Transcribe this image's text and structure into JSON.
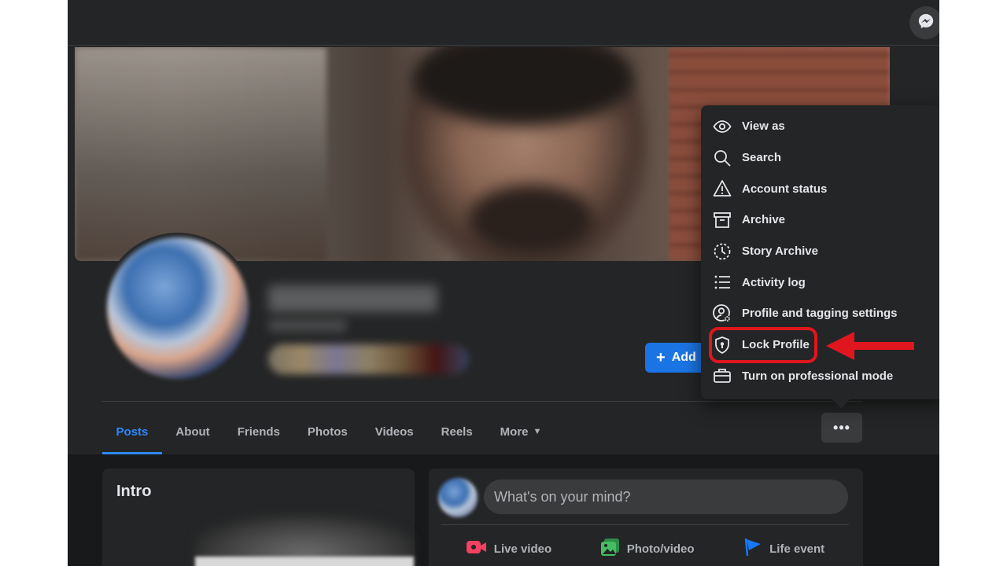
{
  "tabs": [
    {
      "label": "Posts"
    },
    {
      "label": "About"
    },
    {
      "label": "Friends"
    },
    {
      "label": "Photos"
    },
    {
      "label": "Videos"
    },
    {
      "label": "Reels"
    },
    {
      "label": "More"
    }
  ],
  "profile": {
    "add_button_label": "Add",
    "more_options_label": "•••"
  },
  "menu": {
    "items": [
      {
        "label": "View as",
        "icon": "eye-icon"
      },
      {
        "label": "Search",
        "icon": "search-icon"
      },
      {
        "label": "Account status",
        "icon": "warning-icon"
      },
      {
        "label": "Archive",
        "icon": "archive-icon"
      },
      {
        "label": "Story Archive",
        "icon": "clock-icon"
      },
      {
        "label": "Activity log",
        "icon": "list-icon"
      },
      {
        "label": "Profile and tagging settings",
        "icon": "user-settings-icon"
      },
      {
        "label": "Lock Profile",
        "icon": "shield-lock-icon"
      },
      {
        "label": "Turn on professional mode",
        "icon": "briefcase-icon"
      }
    ],
    "highlighted": "Lock Profile"
  },
  "intro": {
    "title": "Intro"
  },
  "composer": {
    "placeholder": "What's on your mind?",
    "actions": [
      {
        "label": "Live video",
        "icon": "live-video-icon",
        "color": "#f3425f"
      },
      {
        "label": "Photo/video",
        "icon": "photo-icon",
        "color": "#45bd62"
      },
      {
        "label": "Life event",
        "icon": "flag-icon",
        "color": "#1877f2"
      }
    ]
  },
  "colors": {
    "accent": "#2d88ff",
    "annotation_red": "#e0161e",
    "page_bg": "#18191a",
    "card_bg": "#242526"
  }
}
